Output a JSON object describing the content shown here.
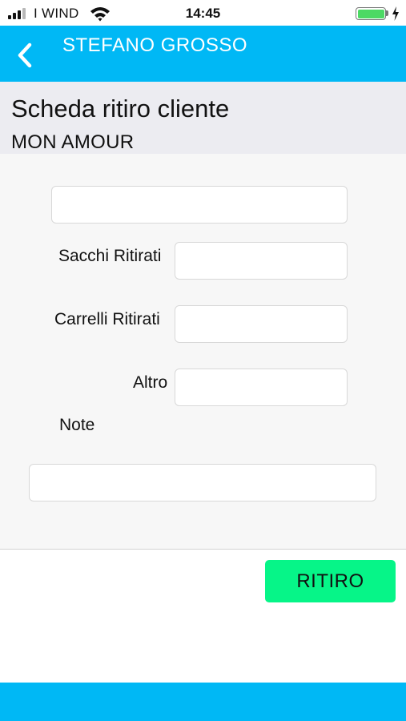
{
  "status_bar": {
    "carrier": "I WIND",
    "time": "14:45",
    "signal_icon": "signal-bars-icon",
    "wifi_icon": "wifi-icon",
    "battery_icon": "battery-charging-icon",
    "battery_level": 1.0
  },
  "nav": {
    "title": "STEFANO GROSSO",
    "back_icon": "chevron-left-icon",
    "background_color": "#00b8f5"
  },
  "header": {
    "title": "Scheda ritiro cliente",
    "client": "MON AMOUR"
  },
  "form": {
    "top_field": {
      "value": "",
      "placeholder": ""
    },
    "sacchi": {
      "label": "Sacchi Ritirati",
      "value": ""
    },
    "carrelli": {
      "label": "Carrelli Ritirati",
      "value": ""
    },
    "altro": {
      "label": "Altro",
      "value": ""
    },
    "note": {
      "label": "Note",
      "value": ""
    }
  },
  "actions": {
    "submit_label": "RITIRO",
    "submit_color": "#06f588"
  }
}
